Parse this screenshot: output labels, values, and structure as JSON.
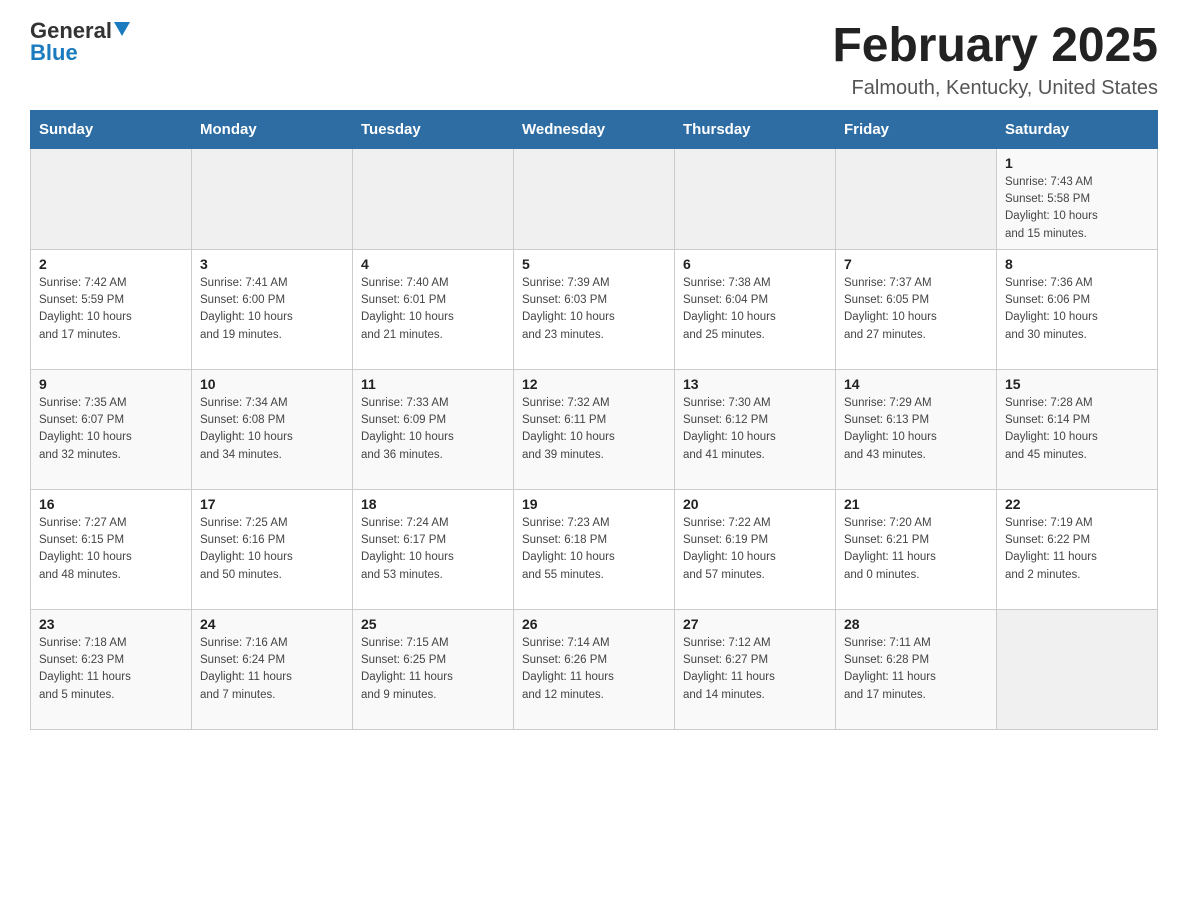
{
  "header": {
    "logo_general": "General",
    "logo_blue": "Blue",
    "month_title": "February 2025",
    "location": "Falmouth, Kentucky, United States"
  },
  "days_of_week": [
    "Sunday",
    "Monday",
    "Tuesday",
    "Wednesday",
    "Thursday",
    "Friday",
    "Saturday"
  ],
  "weeks": [
    [
      {
        "day": "",
        "info": ""
      },
      {
        "day": "",
        "info": ""
      },
      {
        "day": "",
        "info": ""
      },
      {
        "day": "",
        "info": ""
      },
      {
        "day": "",
        "info": ""
      },
      {
        "day": "",
        "info": ""
      },
      {
        "day": "1",
        "info": "Sunrise: 7:43 AM\nSunset: 5:58 PM\nDaylight: 10 hours\nand 15 minutes."
      }
    ],
    [
      {
        "day": "2",
        "info": "Sunrise: 7:42 AM\nSunset: 5:59 PM\nDaylight: 10 hours\nand 17 minutes."
      },
      {
        "day": "3",
        "info": "Sunrise: 7:41 AM\nSunset: 6:00 PM\nDaylight: 10 hours\nand 19 minutes."
      },
      {
        "day": "4",
        "info": "Sunrise: 7:40 AM\nSunset: 6:01 PM\nDaylight: 10 hours\nand 21 minutes."
      },
      {
        "day": "5",
        "info": "Sunrise: 7:39 AM\nSunset: 6:03 PM\nDaylight: 10 hours\nand 23 minutes."
      },
      {
        "day": "6",
        "info": "Sunrise: 7:38 AM\nSunset: 6:04 PM\nDaylight: 10 hours\nand 25 minutes."
      },
      {
        "day": "7",
        "info": "Sunrise: 7:37 AM\nSunset: 6:05 PM\nDaylight: 10 hours\nand 27 minutes."
      },
      {
        "day": "8",
        "info": "Sunrise: 7:36 AM\nSunset: 6:06 PM\nDaylight: 10 hours\nand 30 minutes."
      }
    ],
    [
      {
        "day": "9",
        "info": "Sunrise: 7:35 AM\nSunset: 6:07 PM\nDaylight: 10 hours\nand 32 minutes."
      },
      {
        "day": "10",
        "info": "Sunrise: 7:34 AM\nSunset: 6:08 PM\nDaylight: 10 hours\nand 34 minutes."
      },
      {
        "day": "11",
        "info": "Sunrise: 7:33 AM\nSunset: 6:09 PM\nDaylight: 10 hours\nand 36 minutes."
      },
      {
        "day": "12",
        "info": "Sunrise: 7:32 AM\nSunset: 6:11 PM\nDaylight: 10 hours\nand 39 minutes."
      },
      {
        "day": "13",
        "info": "Sunrise: 7:30 AM\nSunset: 6:12 PM\nDaylight: 10 hours\nand 41 minutes."
      },
      {
        "day": "14",
        "info": "Sunrise: 7:29 AM\nSunset: 6:13 PM\nDaylight: 10 hours\nand 43 minutes."
      },
      {
        "day": "15",
        "info": "Sunrise: 7:28 AM\nSunset: 6:14 PM\nDaylight: 10 hours\nand 45 minutes."
      }
    ],
    [
      {
        "day": "16",
        "info": "Sunrise: 7:27 AM\nSunset: 6:15 PM\nDaylight: 10 hours\nand 48 minutes."
      },
      {
        "day": "17",
        "info": "Sunrise: 7:25 AM\nSunset: 6:16 PM\nDaylight: 10 hours\nand 50 minutes."
      },
      {
        "day": "18",
        "info": "Sunrise: 7:24 AM\nSunset: 6:17 PM\nDaylight: 10 hours\nand 53 minutes."
      },
      {
        "day": "19",
        "info": "Sunrise: 7:23 AM\nSunset: 6:18 PM\nDaylight: 10 hours\nand 55 minutes."
      },
      {
        "day": "20",
        "info": "Sunrise: 7:22 AM\nSunset: 6:19 PM\nDaylight: 10 hours\nand 57 minutes."
      },
      {
        "day": "21",
        "info": "Sunrise: 7:20 AM\nSunset: 6:21 PM\nDaylight: 11 hours\nand 0 minutes."
      },
      {
        "day": "22",
        "info": "Sunrise: 7:19 AM\nSunset: 6:22 PM\nDaylight: 11 hours\nand 2 minutes."
      }
    ],
    [
      {
        "day": "23",
        "info": "Sunrise: 7:18 AM\nSunset: 6:23 PM\nDaylight: 11 hours\nand 5 minutes."
      },
      {
        "day": "24",
        "info": "Sunrise: 7:16 AM\nSunset: 6:24 PM\nDaylight: 11 hours\nand 7 minutes."
      },
      {
        "day": "25",
        "info": "Sunrise: 7:15 AM\nSunset: 6:25 PM\nDaylight: 11 hours\nand 9 minutes."
      },
      {
        "day": "26",
        "info": "Sunrise: 7:14 AM\nSunset: 6:26 PM\nDaylight: 11 hours\nand 12 minutes."
      },
      {
        "day": "27",
        "info": "Sunrise: 7:12 AM\nSunset: 6:27 PM\nDaylight: 11 hours\nand 14 minutes."
      },
      {
        "day": "28",
        "info": "Sunrise: 7:11 AM\nSunset: 6:28 PM\nDaylight: 11 hours\nand 17 minutes."
      },
      {
        "day": "",
        "info": ""
      }
    ]
  ]
}
